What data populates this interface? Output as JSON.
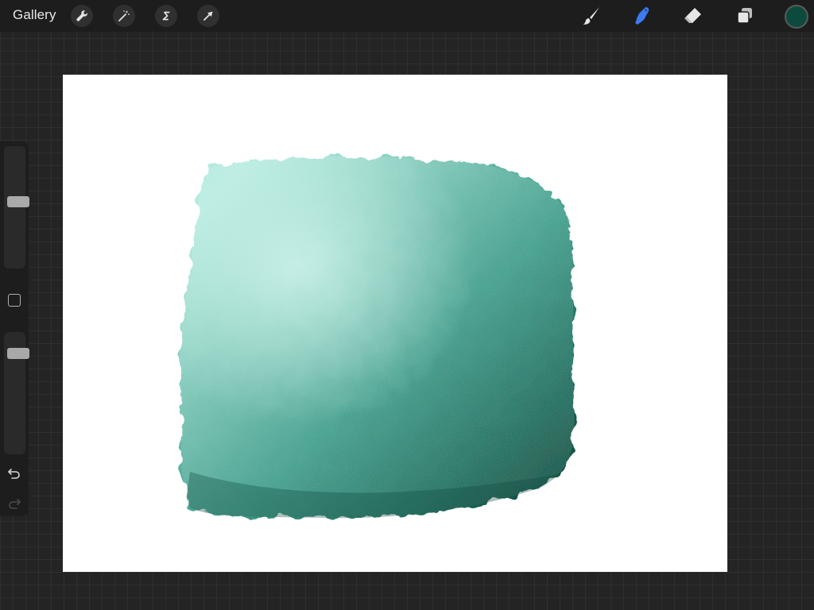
{
  "toolbar": {
    "gallery_label": "Gallery",
    "left_tools": [
      {
        "name": "actions",
        "icon": "wrench-icon"
      },
      {
        "name": "adjustments",
        "icon": "magic-wand-icon"
      },
      {
        "name": "selection",
        "icon": "selection-s-icon"
      },
      {
        "name": "transform",
        "icon": "arrow-cursor-icon"
      }
    ],
    "right_tools": [
      {
        "name": "brush",
        "icon": "paintbrush-icon",
        "active": false
      },
      {
        "name": "smudge",
        "icon": "smudge-finger-icon",
        "active": true
      },
      {
        "name": "eraser",
        "icon": "eraser-icon",
        "active": false
      },
      {
        "name": "layers",
        "icon": "layers-icon",
        "active": false
      }
    ],
    "active_tool_color": "#3d7bf2",
    "current_color": "#0d4a3e"
  },
  "sidebar": {
    "brush_size_level": 0.55,
    "opacity_level": 0.88,
    "modify_button_icon": "square-icon",
    "undo_icon": "undo-arrow-icon",
    "redo_icon": "redo-arrow-icon"
  },
  "canvas": {
    "background": "#ffffff",
    "paint_colors": [
      "#aee8dc",
      "#6fbfae",
      "#3a9a86",
      "#1a6b5a",
      "#0d4a3e"
    ]
  }
}
